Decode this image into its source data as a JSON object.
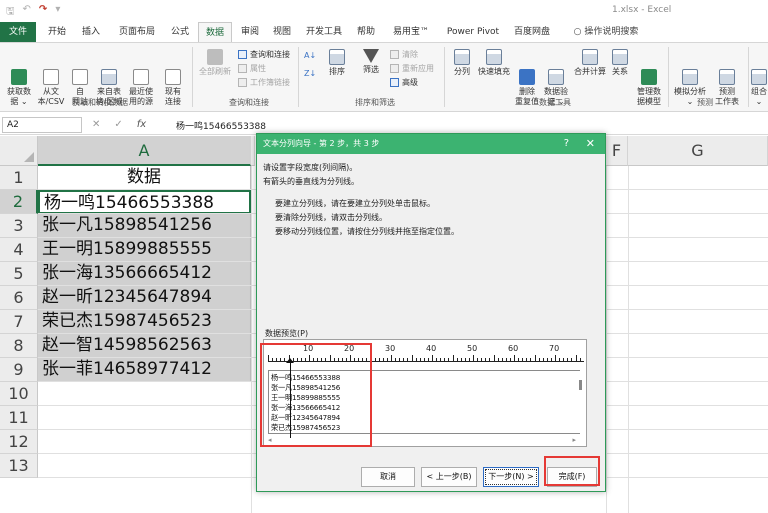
{
  "window": {
    "title": "1.xlsx - Excel"
  },
  "quick_access": {
    "save": "🖫",
    "undo": "↶",
    "redo": "↷",
    "more": "▾"
  },
  "tabs": [
    "文件",
    "开始",
    "插入",
    "页面布局",
    "公式",
    "数据",
    "审阅",
    "视图",
    "开发工具",
    "帮助",
    "易用宝™",
    "Power Pivot",
    "百度网盘"
  ],
  "tell_me": "操作说明搜索",
  "ribbon": {
    "get_data": "获取数\n据 ⌄",
    "from_csv": "从文\n本/CSV",
    "from_web": "自\n网站",
    "from_table": "来自表\n格/区域",
    "recent": "最近使\n用的源",
    "existing": "现有\n连接",
    "group_get": "获取和转换数据",
    "refresh_all": "全部刷新",
    "queries": "查询和连接",
    "properties": "属性",
    "edit_links": "工作簿链接",
    "group_queries": "查询和连接",
    "sort_az": "A↓",
    "sort_za": "Z↓",
    "sort": "排序",
    "filter": "筛选",
    "clear": "清除",
    "reapply": "重新应用",
    "advanced": "高级",
    "group_sort": "排序和筛选",
    "text_to_col": "分列",
    "flash_fill": "快速填充",
    "remove_dup": "删除\n重复值",
    "validation": "数据验\n证 ⌄",
    "consolidate": "合并计算",
    "relationships": "关系",
    "data_model": "管理数\n据模型",
    "group_tools": "数据工具",
    "what_if": "模拟分析\n⌄",
    "forecast": "预测\n工作表",
    "group_forecast": "预测",
    "outline": "组合\n⌄"
  },
  "formula_bar": {
    "name_box": "A2",
    "cancel": "✕",
    "enter": "✓",
    "fx": "fx",
    "value": "杨一鸣15466553388"
  },
  "sheet": {
    "columns": [
      "A",
      "F",
      "G"
    ],
    "rows": [
      "1",
      "2",
      "3",
      "4",
      "5",
      "6",
      "7",
      "8",
      "9",
      "10",
      "11",
      "12",
      "13"
    ],
    "header_cell": "数据",
    "cells": [
      "杨一鸣15466553388",
      "张一凡15898541256",
      "王一明15899885555",
      "张一海13566665412",
      "赵一昕12345647894",
      "荣已杰15987456523",
      "赵一智14598562563",
      "张一菲14658977412"
    ]
  },
  "dialog": {
    "title": "文本分列向导 - 第 2 步，共 3 步",
    "help": "?",
    "close": "✕",
    "instruction_1": "请设置字段宽度(列间隔)。",
    "instruction_2": "有箭头的垂直线为分列线。",
    "tip_1": "要建立分列线，请在要建立分列处单击鼠标。",
    "tip_2": "要清除分列线，请双击分列线。",
    "tip_3": "要移动分列线位置，请按住分列线并拖至指定位置。",
    "preview_label": "数据预览(P)",
    "ruler": [
      "10",
      "20",
      "30",
      "40",
      "50",
      "60",
      "70"
    ],
    "preview_lines": [
      "杨一鸣15466553388",
      "张一凡15898541256",
      "王一明15899885555",
      "张一海13566665412",
      "赵一昕12345647894",
      "荣已杰15987456523"
    ],
    "buttons": {
      "cancel": "取消",
      "back": "< 上一步(B)",
      "next": "下一步(N) >",
      "finish": "完成(F)"
    }
  }
}
